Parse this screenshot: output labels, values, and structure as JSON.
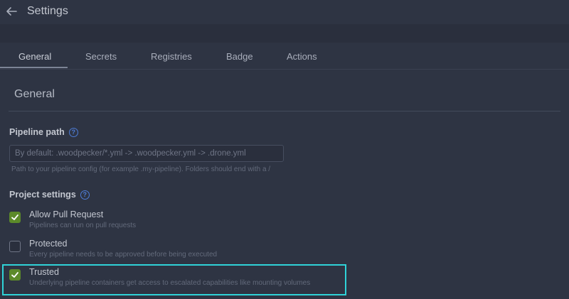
{
  "header": {
    "title": "Settings"
  },
  "tabs": [
    {
      "label": "General",
      "active": true
    },
    {
      "label": "Secrets",
      "active": false
    },
    {
      "label": "Registries",
      "active": false
    },
    {
      "label": "Badge",
      "active": false
    },
    {
      "label": "Actions",
      "active": false
    }
  ],
  "general": {
    "title": "General",
    "pipeline_path": {
      "label": "Pipeline path",
      "placeholder": "By default: .woodpecker/*.yml -> .woodpecker.yml -> .drone.yml",
      "value": "",
      "help": "Path to your pipeline config (for example .my-pipeline). Folders should end with a /"
    },
    "project_settings": {
      "label": "Project settings",
      "options": [
        {
          "label": "Allow Pull Request",
          "description": "Pipelines can run on pull requests",
          "checked": true
        },
        {
          "label": "Protected",
          "description": "Every pipeline needs to be approved before being executed",
          "checked": false
        },
        {
          "label": "Trusted",
          "description": "Underlying pipeline containers get access to escalated capabilities like mounting volumes",
          "checked": true
        }
      ]
    }
  },
  "colors": {
    "background": "#2e3443",
    "checkbox_checked": "#5c8a2a",
    "help_icon": "#4d7cd6",
    "highlight": "#2fd3d8"
  },
  "icons": {
    "back": "arrow-left-icon",
    "help": "question-circle-icon",
    "check": "check-icon"
  }
}
